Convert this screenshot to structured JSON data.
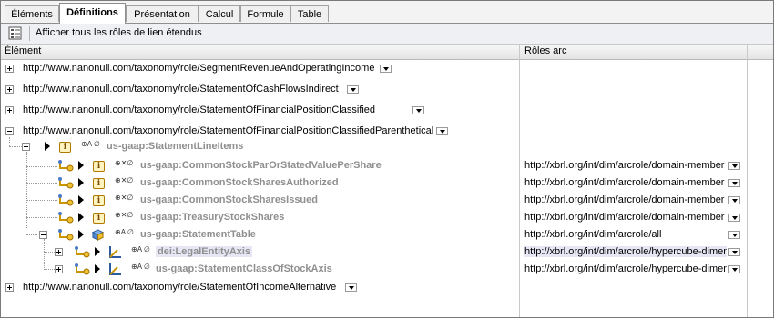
{
  "tabs": [
    {
      "label": "Éléments",
      "active": false
    },
    {
      "label": "Définitions",
      "active": true
    },
    {
      "label": "Présentation",
      "active": false
    },
    {
      "label": "Calcul",
      "active": false
    },
    {
      "label": "Formule",
      "active": false
    },
    {
      "label": "Table",
      "active": false
    }
  ],
  "toolbar": {
    "icon": "list-view-icon",
    "label": "Afficher tous les rôles de lien étendus"
  },
  "columns": {
    "element": "Élément",
    "roles": "Rôles arc"
  },
  "roles": [
    {
      "url": "http://www.nanonull.com/taxonomy/role/SegmentRevenueAndOperatingIncome",
      "expanded": false
    },
    {
      "url": "http://www.nanonull.com/taxonomy/role/StatementOfCashFlowsIndirect",
      "expanded": false
    },
    {
      "url": "http://www.nanonull.com/taxonomy/role/StatementOfFinancialPositionClassified",
      "expanded": false
    },
    {
      "url": "http://www.nanonull.com/taxonomy/role/StatementOfFinancialPositionClassifiedParenthetical",
      "expanded": true
    },
    {
      "url": "http://www.nanonull.com/taxonomy/role/StatementOfIncomeAlternative",
      "expanded": false
    }
  ],
  "tree": {
    "line_items": {
      "label": "us-gaap:StatementLineItems",
      "flags": "⊕A ∅"
    },
    "children": [
      {
        "label": "us-gaap:CommonStockParOrStatedValuePerShare",
        "flags": "⊕✕∅",
        "arcrole": "http://xbrl.org/int/dim/arcrole/domain-member"
      },
      {
        "label": "us-gaap:CommonStockSharesAuthorized",
        "flags": "⊕✕∅",
        "arcrole": "http://xbrl.org/int/dim/arcrole/domain-member"
      },
      {
        "label": "us-gaap:CommonStockSharesIssued",
        "flags": "⊕✕∅",
        "arcrole": "http://xbrl.org/int/dim/arcrole/domain-member"
      },
      {
        "label": "us-gaap:TreasuryStockShares",
        "flags": "⊕✕∅",
        "arcrole": "http://xbrl.org/int/dim/arcrole/domain-member"
      },
      {
        "label": "us-gaap:StatementTable",
        "flags": "⊕A ∅",
        "arcrole": "http://xbrl.org/int/dim/arcrole/all"
      }
    ],
    "axes": [
      {
        "label": "dei:LegalEntityAxis",
        "flags": "⊕A ∅",
        "arcrole": "http://xbrl.org/int/dim/arcrole/hypercube-dimension",
        "selected": true
      },
      {
        "label": "us-gaap:StatementClassOfStockAxis",
        "flags": "⊕A ∅",
        "arcrole": "http://xbrl.org/int/dim/arcrole/hypercube-dimension",
        "selected": false
      }
    ]
  },
  "colors": {
    "accent_gray": "#8f8f8f",
    "selection": "#e6e6f5",
    "icon_yellow": "#fff4c0"
  }
}
